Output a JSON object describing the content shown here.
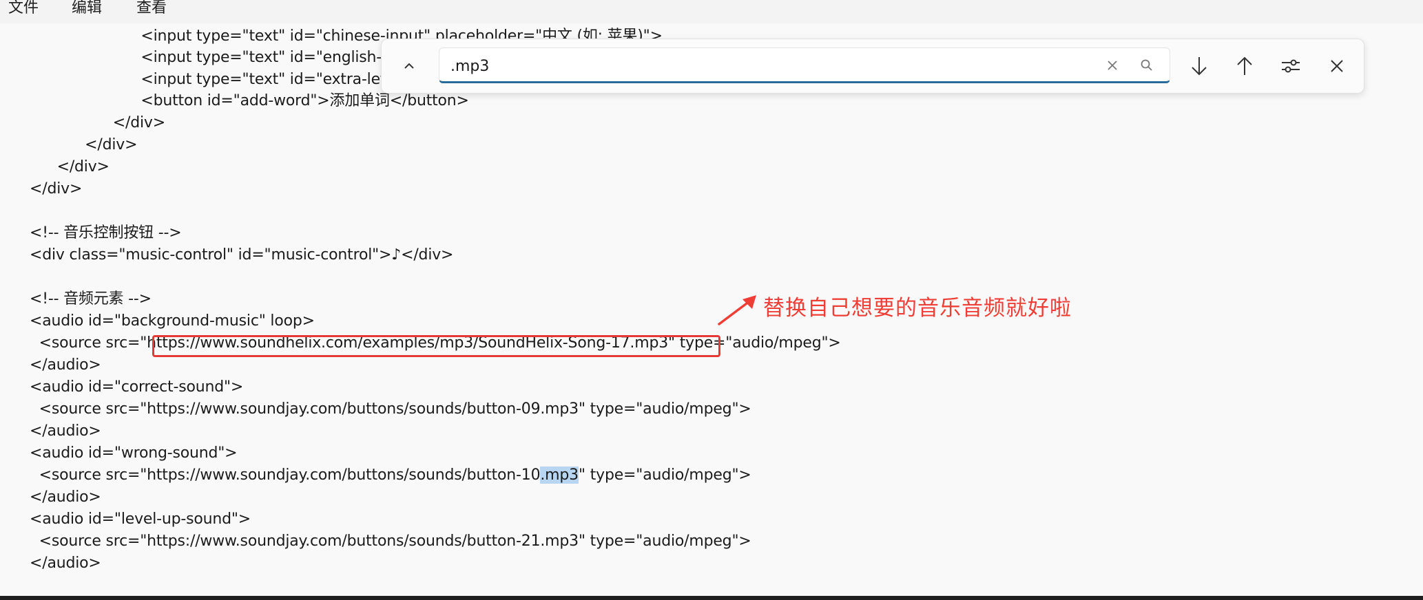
{
  "menu": {
    "file": "文件",
    "edit": "编辑",
    "view": "查看"
  },
  "find": {
    "query": ".mp3"
  },
  "code": [
    "        <input type=\"text\" id=\"chinese-input\" placeholder=\"中文 (如: 苹果)\">",
    "        <input type=\"text\" id=\"english-inp",
    "        <input type=\"text\" id=\"extra-letter",
    "        <button id=\"add-word\">添加单词</button>",
    "      </div>",
    "    </div>",
    "  </div>",
    "</div>",
    "",
    "<!-- 音乐控制按钮 -->",
    "<div class=\"music-control\" id=\"music-control\">♪</div>",
    "",
    "<!-- 音频元素 -->",
    "<audio id=\"background-music\" loop>",
    "  <source src=\"https://www.soundhelix.com/examples/mp3/SoundHelix-Song-17.mp3\" type=\"audio/mpeg\">",
    "</audio>",
    "<audio id=\"correct-sound\">",
    "  <source src=\"https://www.soundjay.com/buttons/sounds/button-09.mp3\" type=\"audio/mpeg\">",
    "</audio>",
    "<audio id=\"wrong-sound\">",
    "  <source src=\"https://www.soundjay.com/buttons/sounds/button-10",
    "</audio>",
    "<audio id=\"level-up-sound\">",
    "  <source src=\"https://www.soundjay.com/buttons/sounds/button-21.mp3\" type=\"audio/mpeg\">",
    "</audio>"
  ],
  "match": {
    "text": ".mp3",
    "after": "\" type=\"audio/mpeg\">"
  },
  "annotation": {
    "text": "替换自己想要的音乐音频就好啦",
    "color": "#ef3e36"
  },
  "colors": {
    "match_highlight": "#b8d6f2",
    "accent": "#2a6a99",
    "annotation_red": "#e53935"
  },
  "icons": {
    "collapse": "chevron-up-icon",
    "next": "arrow-down-icon",
    "prev": "arrow-up-icon",
    "options": "sliders-icon",
    "close": "close-icon",
    "clear": "clear-x-icon",
    "search": "search-icon"
  }
}
